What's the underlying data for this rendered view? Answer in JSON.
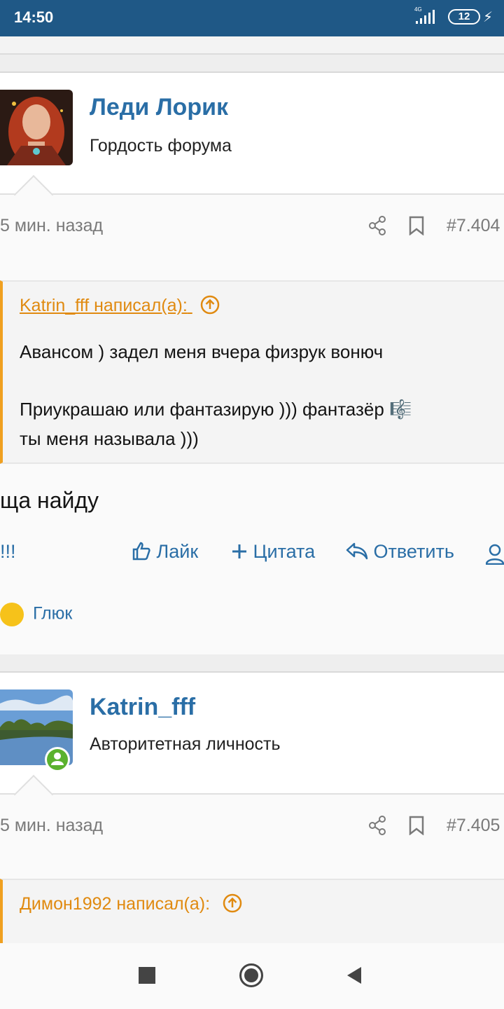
{
  "status": {
    "time": "14:50",
    "network": "4G",
    "battery": "12"
  },
  "posts": [
    {
      "author": "Леди Лорик",
      "rank": "Гордость форума",
      "time": "5 мин. назад",
      "number": "#7.404",
      "quote": {
        "header": "Katrin_fff написал(а):",
        "line1": "Авансом ) задел меня вчера физрук вонюч",
        "line2": "Приукрашаю или фантазирую ))) фантазёр 🎼",
        "line3": "ты меня называла )))"
      },
      "text": "ща найду",
      "actions": {
        "extra": "!!!",
        "like": "Лайк",
        "quote": "Цитата",
        "reply": "Ответить"
      },
      "reaction_user": "Глюк"
    },
    {
      "author": "Katrin_fff",
      "rank": "Авторитетная личность",
      "time": "5 мин. назад",
      "number": "#7.405",
      "quote": {
        "header": "Димон1992 написал(а):"
      }
    }
  ],
  "colors": {
    "accent": "#2a6ea6",
    "quote": "#e08a10",
    "statusbar": "#1f5886"
  }
}
